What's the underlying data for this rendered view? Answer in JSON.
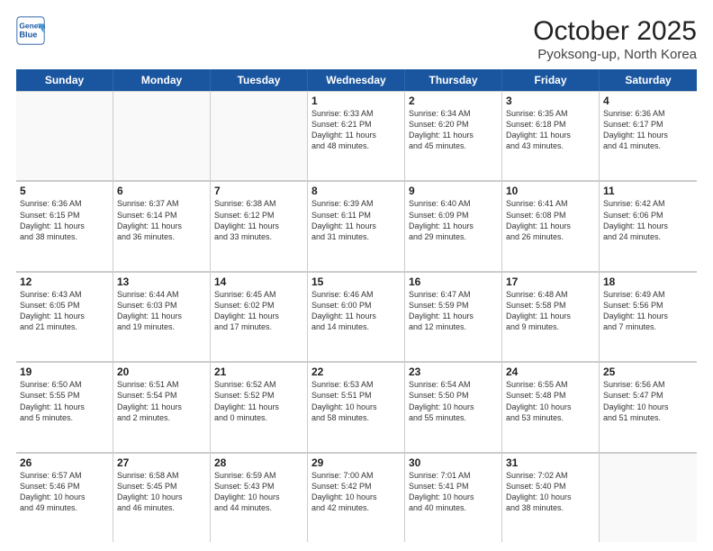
{
  "header": {
    "logo_line1": "General",
    "logo_line2": "Blue",
    "title": "October 2025",
    "subtitle": "Pyoksong-up, North Korea"
  },
  "weekdays": [
    "Sunday",
    "Monday",
    "Tuesday",
    "Wednesday",
    "Thursday",
    "Friday",
    "Saturday"
  ],
  "weeks": [
    [
      {
        "day": "",
        "info": ""
      },
      {
        "day": "",
        "info": ""
      },
      {
        "day": "",
        "info": ""
      },
      {
        "day": "1",
        "info": "Sunrise: 6:33 AM\nSunset: 6:21 PM\nDaylight: 11 hours\nand 48 minutes."
      },
      {
        "day": "2",
        "info": "Sunrise: 6:34 AM\nSunset: 6:20 PM\nDaylight: 11 hours\nand 45 minutes."
      },
      {
        "day": "3",
        "info": "Sunrise: 6:35 AM\nSunset: 6:18 PM\nDaylight: 11 hours\nand 43 minutes."
      },
      {
        "day": "4",
        "info": "Sunrise: 6:36 AM\nSunset: 6:17 PM\nDaylight: 11 hours\nand 41 minutes."
      }
    ],
    [
      {
        "day": "5",
        "info": "Sunrise: 6:36 AM\nSunset: 6:15 PM\nDaylight: 11 hours\nand 38 minutes."
      },
      {
        "day": "6",
        "info": "Sunrise: 6:37 AM\nSunset: 6:14 PM\nDaylight: 11 hours\nand 36 minutes."
      },
      {
        "day": "7",
        "info": "Sunrise: 6:38 AM\nSunset: 6:12 PM\nDaylight: 11 hours\nand 33 minutes."
      },
      {
        "day": "8",
        "info": "Sunrise: 6:39 AM\nSunset: 6:11 PM\nDaylight: 11 hours\nand 31 minutes."
      },
      {
        "day": "9",
        "info": "Sunrise: 6:40 AM\nSunset: 6:09 PM\nDaylight: 11 hours\nand 29 minutes."
      },
      {
        "day": "10",
        "info": "Sunrise: 6:41 AM\nSunset: 6:08 PM\nDaylight: 11 hours\nand 26 minutes."
      },
      {
        "day": "11",
        "info": "Sunrise: 6:42 AM\nSunset: 6:06 PM\nDaylight: 11 hours\nand 24 minutes."
      }
    ],
    [
      {
        "day": "12",
        "info": "Sunrise: 6:43 AM\nSunset: 6:05 PM\nDaylight: 11 hours\nand 21 minutes."
      },
      {
        "day": "13",
        "info": "Sunrise: 6:44 AM\nSunset: 6:03 PM\nDaylight: 11 hours\nand 19 minutes."
      },
      {
        "day": "14",
        "info": "Sunrise: 6:45 AM\nSunset: 6:02 PM\nDaylight: 11 hours\nand 17 minutes."
      },
      {
        "day": "15",
        "info": "Sunrise: 6:46 AM\nSunset: 6:00 PM\nDaylight: 11 hours\nand 14 minutes."
      },
      {
        "day": "16",
        "info": "Sunrise: 6:47 AM\nSunset: 5:59 PM\nDaylight: 11 hours\nand 12 minutes."
      },
      {
        "day": "17",
        "info": "Sunrise: 6:48 AM\nSunset: 5:58 PM\nDaylight: 11 hours\nand 9 minutes."
      },
      {
        "day": "18",
        "info": "Sunrise: 6:49 AM\nSunset: 5:56 PM\nDaylight: 11 hours\nand 7 minutes."
      }
    ],
    [
      {
        "day": "19",
        "info": "Sunrise: 6:50 AM\nSunset: 5:55 PM\nDaylight: 11 hours\nand 5 minutes."
      },
      {
        "day": "20",
        "info": "Sunrise: 6:51 AM\nSunset: 5:54 PM\nDaylight: 11 hours\nand 2 minutes."
      },
      {
        "day": "21",
        "info": "Sunrise: 6:52 AM\nSunset: 5:52 PM\nDaylight: 11 hours\nand 0 minutes."
      },
      {
        "day": "22",
        "info": "Sunrise: 6:53 AM\nSunset: 5:51 PM\nDaylight: 10 hours\nand 58 minutes."
      },
      {
        "day": "23",
        "info": "Sunrise: 6:54 AM\nSunset: 5:50 PM\nDaylight: 10 hours\nand 55 minutes."
      },
      {
        "day": "24",
        "info": "Sunrise: 6:55 AM\nSunset: 5:48 PM\nDaylight: 10 hours\nand 53 minutes."
      },
      {
        "day": "25",
        "info": "Sunrise: 6:56 AM\nSunset: 5:47 PM\nDaylight: 10 hours\nand 51 minutes."
      }
    ],
    [
      {
        "day": "26",
        "info": "Sunrise: 6:57 AM\nSunset: 5:46 PM\nDaylight: 10 hours\nand 49 minutes."
      },
      {
        "day": "27",
        "info": "Sunrise: 6:58 AM\nSunset: 5:45 PM\nDaylight: 10 hours\nand 46 minutes."
      },
      {
        "day": "28",
        "info": "Sunrise: 6:59 AM\nSunset: 5:43 PM\nDaylight: 10 hours\nand 44 minutes."
      },
      {
        "day": "29",
        "info": "Sunrise: 7:00 AM\nSunset: 5:42 PM\nDaylight: 10 hours\nand 42 minutes."
      },
      {
        "day": "30",
        "info": "Sunrise: 7:01 AM\nSunset: 5:41 PM\nDaylight: 10 hours\nand 40 minutes."
      },
      {
        "day": "31",
        "info": "Sunrise: 7:02 AM\nSunset: 5:40 PM\nDaylight: 10 hours\nand 38 minutes."
      },
      {
        "day": "",
        "info": ""
      }
    ]
  ]
}
